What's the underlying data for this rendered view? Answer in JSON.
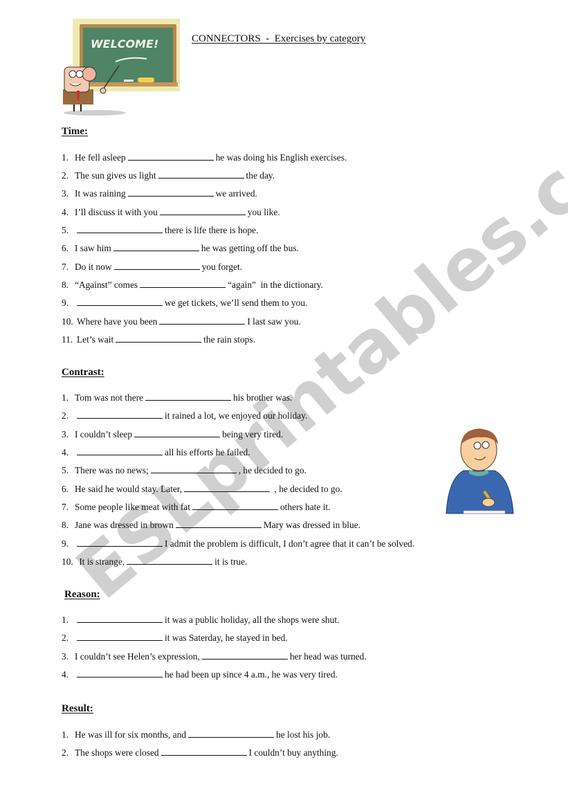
{
  "header": {
    "title": "CONNECTORS  -  Exercises by category",
    "chalkboard_text": "WELCOME!"
  },
  "watermark": {
    "text": "ESLprintables.com",
    "color": "#c8c8c8"
  },
  "sections": [
    {
      "heading": "Time:",
      "items": [
        {
          "num": "1.",
          "before": "He fell asleep",
          "after": "he was doing his English exercises."
        },
        {
          "num": "2.",
          "before": "The sun gives us light",
          "after": "the day."
        },
        {
          "num": "3.",
          "before": "It was raining",
          "after": "we arrived."
        },
        {
          "num": "4.",
          "before": "I’ll discuss it with you",
          "after": "you like."
        },
        {
          "num": "5.",
          "before": "",
          "after": "there is life there is hope."
        },
        {
          "num": "6.",
          "before": "I saw him",
          "after": "he was getting off the bus."
        },
        {
          "num": "7.",
          "before": "Do it now",
          "after": "you forget."
        },
        {
          "num": "8.",
          "before": "“Against” comes",
          "after": "“again”  in the dictionary."
        },
        {
          "num": "9.",
          "before": "",
          "after": "we get tickets, we’ll send them to you."
        },
        {
          "num": "10.",
          "before": "Where have you been",
          "after": "I last saw you."
        },
        {
          "num": "11.",
          "before": "Let’s wait",
          "after": "the rain stops."
        }
      ]
    },
    {
      "heading": "Contrast:",
      "items": [
        {
          "num": "1.",
          "before": "Tom was not there",
          "after": "his brother was."
        },
        {
          "num": "2.",
          "before": "",
          "after": "it rained a lot, we enjoyed our holiday."
        },
        {
          "num": "3.",
          "before": "I couldn’t sleep",
          "after": "being very tired."
        },
        {
          "num": "4.",
          "before": "",
          "after": "all his efforts he failed."
        },
        {
          "num": "5.",
          "before": "There was no news;",
          "after": ", he decided to go."
        },
        {
          "num": "6.",
          "before": "He said he would stay. Later,",
          "after": " , he decided to go."
        },
        {
          "num": "7.",
          "before": "Some people like meat with fat",
          "after": "others hate it."
        },
        {
          "num": "8.",
          "before": "Jane was dressed in brown",
          "after": "Mary was dressed in blue."
        },
        {
          "num": "9.",
          "before": "",
          "after": "I admit the problem is difficult, I don’t agree that it can’t be solved."
        },
        {
          "num": "10.",
          "before": " It is strange,",
          "after": "it is true."
        }
      ]
    },
    {
      "heading": "Reason:",
      "items": [
        {
          "num": "1.",
          "before": "",
          "after": "it was a public holiday, all the shops were shut."
        },
        {
          "num": "2.",
          "before": "",
          "after": "it was Saterday, he stayed in bed."
        },
        {
          "num": "3.",
          "before": "I couldn’t see Helen’s expression,",
          "after": "her head was turned."
        },
        {
          "num": "4.",
          "before": "",
          "after": "he had been up since 4 a.m., he was very tired."
        }
      ]
    },
    {
      "heading": "Result:",
      "items": [
        {
          "num": "1.",
          "before": "He was ill for six months, and",
          "after": "he lost his job."
        },
        {
          "num": "2.",
          "before": "The shops were closed",
          "after": "I couldn’t buy anything."
        }
      ]
    }
  ]
}
